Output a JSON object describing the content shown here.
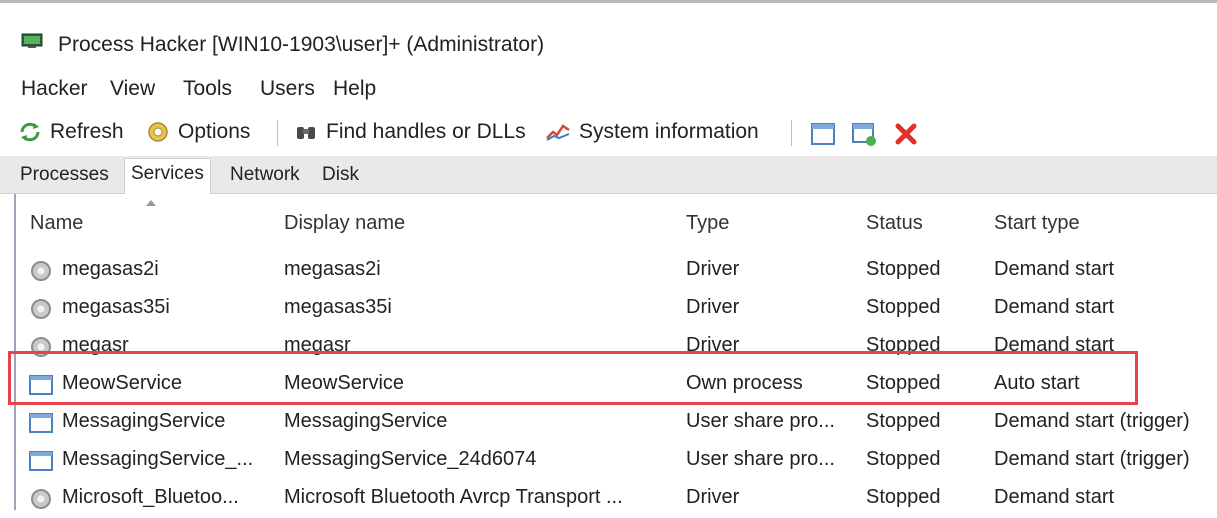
{
  "window": {
    "title": "Process Hacker [WIN10-1903\\user]+ (Administrator)"
  },
  "menu": [
    "Hacker",
    "View",
    "Tools",
    "Users",
    "Help"
  ],
  "toolbar": {
    "refresh": "Refresh",
    "options": "Options",
    "find_handles": "Find handles or DLLs",
    "system_info": "System information"
  },
  "tabs": [
    "Processes",
    "Services",
    "Network",
    "Disk"
  ],
  "active_tab": "Services",
  "columns": [
    "Name",
    "Display name",
    "Type",
    "Status",
    "Start type"
  ],
  "rows": [
    {
      "name": "megasas2i",
      "display": "megasas2i",
      "type": "Driver",
      "status": "Stopped",
      "start": "Demand start",
      "icon": "gear-icon"
    },
    {
      "name": "megasas35i",
      "display": "megasas35i",
      "type": "Driver",
      "status": "Stopped",
      "start": "Demand start",
      "icon": "gear-icon"
    },
    {
      "name": "megasr",
      "display": "megasr",
      "type": "Driver",
      "status": "Stopped",
      "start": "Demand start",
      "icon": "gear-icon"
    },
    {
      "name": "MeowService",
      "display": "MeowService",
      "type": "Own process",
      "status": "Stopped",
      "start": "Auto start",
      "icon": "window-icon"
    },
    {
      "name": "MessagingService",
      "display": "MessagingService",
      "type": "User share pro...",
      "status": "Stopped",
      "start": "Demand start (trigger)",
      "icon": "window-icon"
    },
    {
      "name": "MessagingService_...",
      "display": "MessagingService_24d6074",
      "type": "User share pro...",
      "status": "Stopped",
      "start": "Demand start (trigger)",
      "icon": "window-icon"
    },
    {
      "name": "Microsoft_Bluetoo...",
      "display": "Microsoft Bluetooth Avrcp Transport ...",
      "type": "Driver",
      "status": "Stopped",
      "start": "Demand start",
      "icon": "gear-icon"
    }
  ],
  "highlight_color": "#e8424a"
}
